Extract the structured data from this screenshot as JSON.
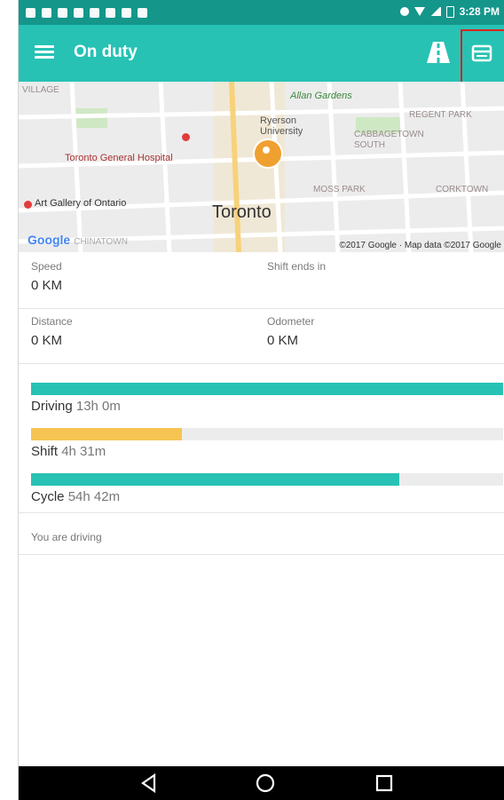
{
  "status_bar": {
    "time": "3:28 PM"
  },
  "app_bar": {
    "title": "On duty"
  },
  "map": {
    "labels": {
      "village": "VILLAGE",
      "allan_gardens": "Allan Gardens",
      "ryerson": "Ryerson University",
      "regent_park": "REGENT PARK",
      "cabbagetown": "CABBAGETOWN SOUTH",
      "hospital": "Toronto General Hospital",
      "moss_park": "MOSS PARK",
      "corktown": "CORKTOWN",
      "art_gallery": "Art Gallery of Ontario",
      "toronto": "Toronto",
      "chinatown": "CHINATOWN",
      "google": "Google",
      "credit": "©2017 Google · Map data ©2017 Google"
    }
  },
  "info": {
    "speed_label": "Speed",
    "speed_value": "0 KM",
    "shift_ends_label": "Shift ends in",
    "distance_label": "Distance",
    "distance_value": "0  KM",
    "odometer_label": "Odometer",
    "odometer_value": "0  KM"
  },
  "duty": {
    "driving": {
      "label": "Driving",
      "time": "13h 0m",
      "fraction": 1.0,
      "color": "#27c2b4"
    },
    "shift": {
      "label": "Shift",
      "time": "4h 31m",
      "fraction": 0.32,
      "color": "#f6c453"
    },
    "cycle": {
      "label": "Cycle",
      "time": "54h 42m",
      "fraction": 0.78,
      "color": "#27c2b4"
    }
  },
  "status_message": "You are driving",
  "icons": {
    "menu": "hamburger-menu-icon",
    "road": "road-icon",
    "card": "card-icon",
    "back": "back-triangle-icon",
    "home": "home-circle-icon",
    "recents": "recents-square-icon"
  }
}
